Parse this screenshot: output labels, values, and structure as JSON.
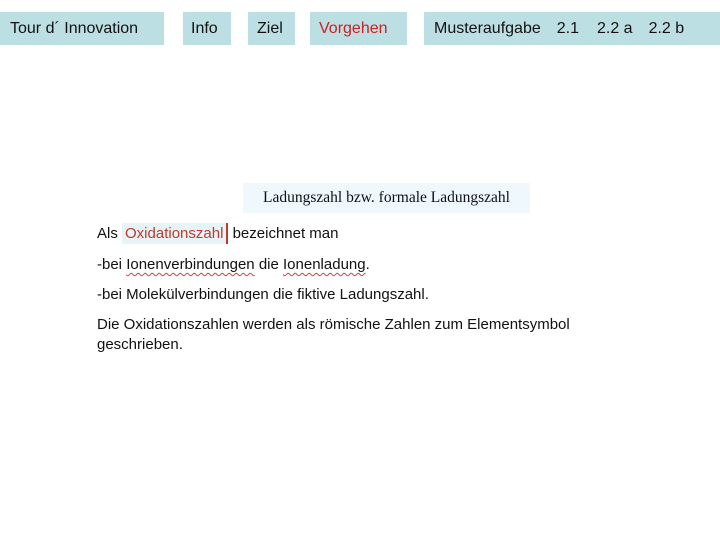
{
  "nav": {
    "tour": "Tour d´ Innovation",
    "info": "Info",
    "ziel": "Ziel",
    "vorgehen": "Vorgehen",
    "musteraufgabe": {
      "title": "Musteraufgabe",
      "items": [
        "2.1",
        "2.2 a",
        "2.2 b"
      ]
    },
    "active": "Vorgehen",
    "active_color": "#cc1f1f",
    "button_color": "#bcdfe4"
  },
  "content": {
    "heading": "Ladungszahl bzw. formale Ladungszahl",
    "line1": {
      "before": "Als",
      "highlight": "Oxidationszahl",
      "after": "bezeichnet man"
    },
    "line2": {
      "prefix": "-bei",
      "word1": "Ionenverbindungen",
      "middle": "die",
      "word2": "Ionenladung",
      "suffix": "."
    },
    "line3": "-bei Molekülverbindungen die fiktive Ladungszahl.",
    "paragraph_line1": "Die Oxidationszahlen werden als römische Zahlen zum Elementsymbol",
    "paragraph_line2": "geschrieben."
  }
}
